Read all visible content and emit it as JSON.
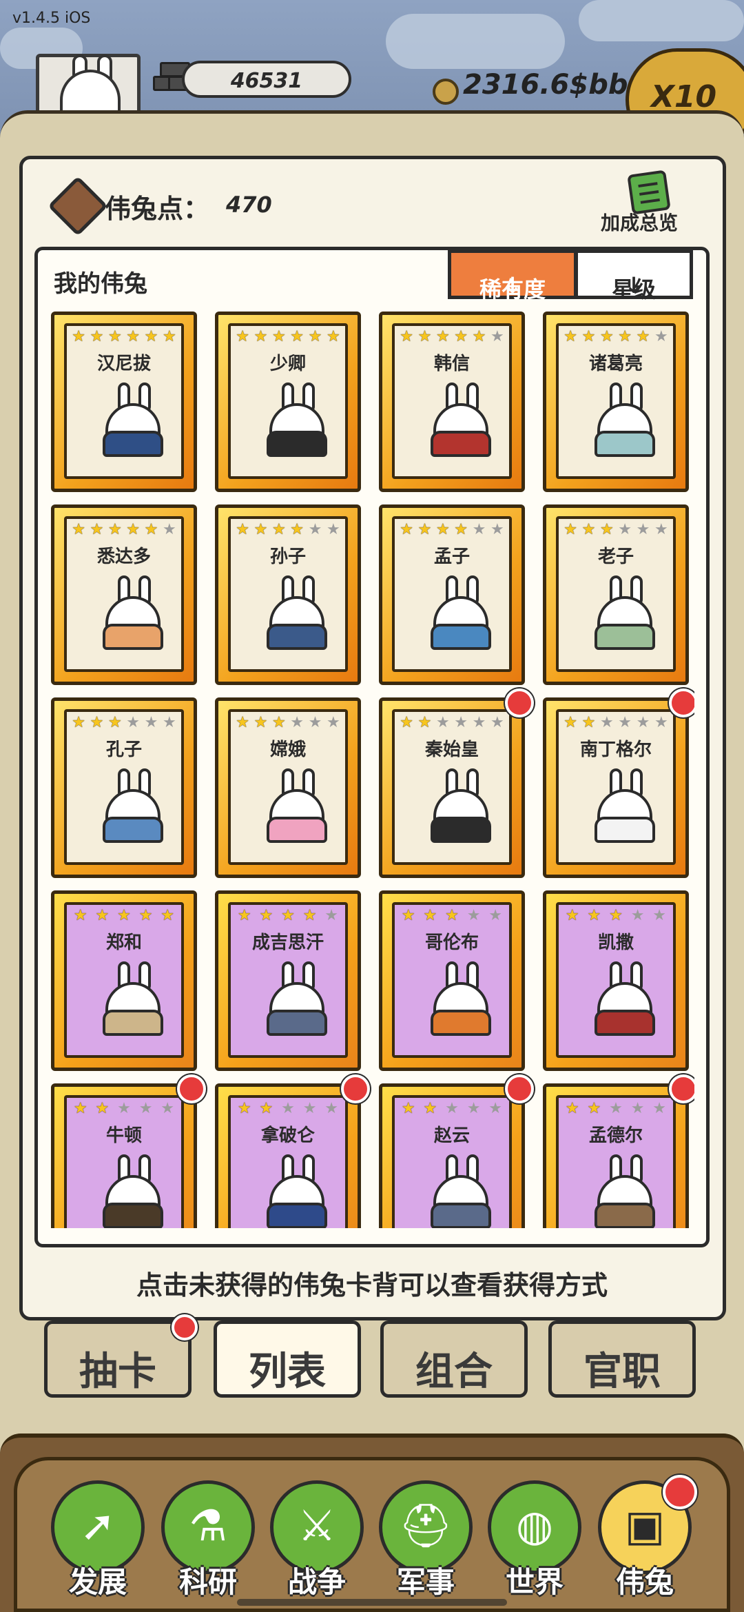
{
  "app": {
    "version": "v1.4.5 iOS"
  },
  "hud": {
    "money": "46531",
    "coins": "2316.6$bb",
    "speed": "X10"
  },
  "panel": {
    "points_label": "伟兔点：",
    "points_value": "470",
    "bonus_label": "加成总览",
    "list_title": "我的伟兔",
    "sort_rarity_label": "稀有度",
    "sort_star_label": "星级",
    "hint": "点击未获得的伟兔卡背可以查看获得方式"
  },
  "cards": [
    {
      "name": "汉尼拔",
      "stars": 6,
      "filled": 6,
      "tier": "gold",
      "robe": "#2f4f86",
      "new": false
    },
    {
      "name": "少卿",
      "stars": 6,
      "filled": 6,
      "tier": "gold",
      "robe": "#2b2b2b",
      "new": false
    },
    {
      "name": "韩信",
      "stars": 6,
      "filled": 5,
      "tier": "gold",
      "robe": "#b3342e",
      "new": false
    },
    {
      "name": "诸葛亮",
      "stars": 6,
      "filled": 5,
      "tier": "gold",
      "robe": "#9cc7c9",
      "new": false
    },
    {
      "name": "悉达多",
      "stars": 6,
      "filled": 5,
      "tier": "gold",
      "robe": "#e8a36a",
      "new": false
    },
    {
      "name": "孙子",
      "stars": 6,
      "filled": 4,
      "tier": "gold",
      "robe": "#3b5a8a",
      "new": false
    },
    {
      "name": "孟子",
      "stars": 6,
      "filled": 4,
      "tier": "gold",
      "robe": "#4a88c0",
      "new": false
    },
    {
      "name": "老子",
      "stars": 6,
      "filled": 3,
      "tier": "gold",
      "robe": "#9cbf98",
      "new": false
    },
    {
      "name": "孔子",
      "stars": 6,
      "filled": 3,
      "tier": "gold",
      "robe": "#5a8ac0",
      "new": false
    },
    {
      "name": "嫦娥",
      "stars": 6,
      "filled": 3,
      "tier": "gold",
      "robe": "#f0a3c0",
      "new": false
    },
    {
      "name": "秦始皇",
      "stars": 6,
      "filled": 2,
      "tier": "gold",
      "robe": "#2b2b2b",
      "new": true
    },
    {
      "name": "南丁格尔",
      "stars": 6,
      "filled": 2,
      "tier": "gold",
      "robe": "#f3f3f3",
      "new": true
    },
    {
      "name": "郑和",
      "stars": 5,
      "filled": 5,
      "tier": "purple",
      "robe": "#cdb58a",
      "new": false
    },
    {
      "name": "成吉思汗",
      "stars": 5,
      "filled": 4,
      "tier": "purple",
      "robe": "#5a6a8a",
      "new": false
    },
    {
      "name": "哥伦布",
      "stars": 5,
      "filled": 3,
      "tier": "purple",
      "robe": "#e07a2e",
      "new": false
    },
    {
      "name": "凯撒",
      "stars": 5,
      "filled": 3,
      "tier": "purple",
      "robe": "#a8322e",
      "new": false
    },
    {
      "name": "牛顿",
      "stars": 5,
      "filled": 2,
      "tier": "purple",
      "robe": "#4a3a28",
      "new": true
    },
    {
      "name": "拿破仑",
      "stars": 5,
      "filled": 2,
      "tier": "purple",
      "robe": "#2e4a8a",
      "new": true
    },
    {
      "name": "赵云",
      "stars": 5,
      "filled": 2,
      "tier": "purple",
      "robe": "#5a6a8a",
      "new": true
    },
    {
      "name": "孟德尔",
      "stars": 5,
      "filled": 2,
      "tier": "purple",
      "robe": "#8a6a4a",
      "new": true
    }
  ],
  "tabs": [
    {
      "label": "抽卡",
      "active": false,
      "dot": true
    },
    {
      "label": "列表",
      "active": true,
      "dot": false
    },
    {
      "label": "组合",
      "active": false,
      "dot": false
    },
    {
      "label": "官职",
      "active": false,
      "dot": false
    }
  ],
  "nav": [
    {
      "label": "发展",
      "icon": "arrow-up-icon",
      "glyph": "➚",
      "active": false
    },
    {
      "label": "科研",
      "icon": "flask-icon",
      "glyph": "⚗",
      "active": false
    },
    {
      "label": "战争",
      "icon": "crossed-swords-icon",
      "glyph": "⚔",
      "active": false
    },
    {
      "label": "军事",
      "icon": "helmet-icon",
      "glyph": "⛑",
      "active": false
    },
    {
      "label": "世界",
      "icon": "globe-icon",
      "glyph": "◍",
      "active": false
    },
    {
      "label": "伟兔",
      "icon": "rabbit-card-icon",
      "glyph": "▣",
      "active": true
    }
  ],
  "colors": {
    "sort_active": "#ee7e3e",
    "nav_green": "#6ab43c",
    "nav_active": "#f6d25a",
    "red_dot": "#e63b3b"
  }
}
